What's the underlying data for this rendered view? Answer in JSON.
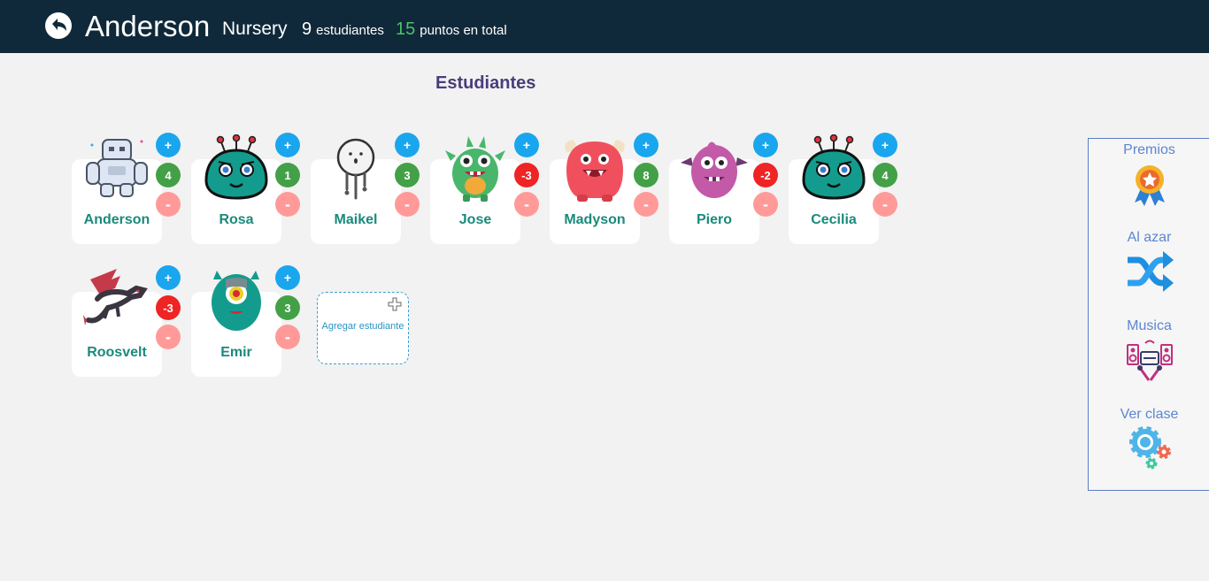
{
  "header": {
    "title": "Anderson",
    "class_name": "Nursery",
    "students_count": "9",
    "students_label": "estudiantes",
    "points_total": "15",
    "points_label": "puntos en total"
  },
  "section_title": "Estudiantes",
  "buttons": {
    "plus": "+",
    "minus": "-"
  },
  "students": [
    {
      "name": "Anderson",
      "points": "4",
      "avatar": "robot-monster-icon"
    },
    {
      "name": "Rosa",
      "points": "1",
      "avatar": "green-alien-monster-icon"
    },
    {
      "name": "Maikel",
      "points": "3",
      "avatar": "ghost-monster-icon"
    },
    {
      "name": "Jose",
      "points": "-3",
      "avatar": "green-spiky-monster-icon"
    },
    {
      "name": "Madyson",
      "points": "8",
      "avatar": "red-furry-monster-icon"
    },
    {
      "name": "Piero",
      "points": "-2",
      "avatar": "purple-monster-icon"
    },
    {
      "name": "Cecilia",
      "points": "4",
      "avatar": "green-alien-monster-icon"
    },
    {
      "name": "Roosvelt",
      "points": "-3",
      "avatar": "dragon-monster-icon"
    },
    {
      "name": "Emir",
      "points": "3",
      "avatar": "cyclops-monster-icon"
    }
  ],
  "add_student": {
    "label": "Agregar estudiante"
  },
  "sidebar": {
    "items": [
      {
        "label": "Premios",
        "icon": "award-medal-icon"
      },
      {
        "label": "Al azar",
        "icon": "shuffle-icon"
      },
      {
        "label": "Musica",
        "icon": "music-speakers-icon"
      },
      {
        "label": "Ver clase",
        "icon": "gears-icon"
      }
    ]
  },
  "colors": {
    "topbar": "#10293a",
    "points_total": "#4cc267",
    "plus_button": "#1aa6ee",
    "minus_button": "#ff9a98",
    "score_positive": "#43a047",
    "score_negative": "#ef2424",
    "student_name": "#1a8a7c",
    "sidebar_text": "#5b86d1"
  }
}
